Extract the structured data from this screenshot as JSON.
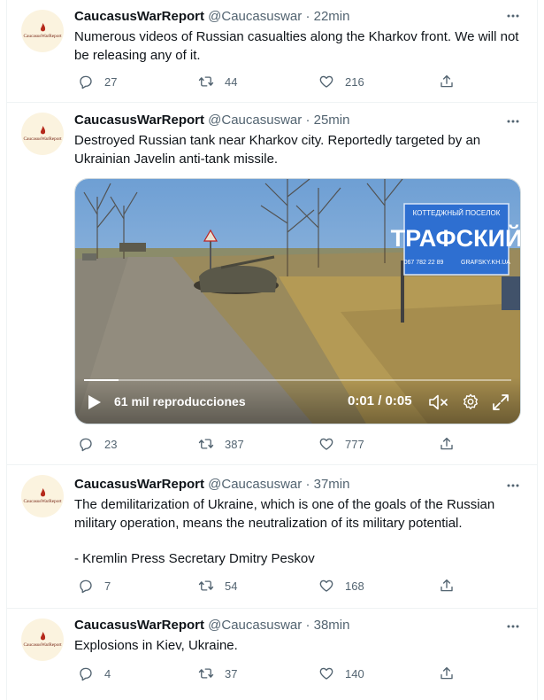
{
  "account": {
    "name": "CaucasusWarReport",
    "handle": "@Caucasuswar",
    "avatar_text": "CaucasusWarReport"
  },
  "tweets": [
    {
      "time": "22min",
      "text": [
        "Numerous videos of Russian casualties along the Kharkov front. We will not be releasing any of it."
      ],
      "replies": "27",
      "retweets": "44",
      "likes": "216"
    },
    {
      "time": "25min",
      "text": [
        "Destroyed Russian tank near Kharkov city. Reportedly targeted by an Ukrainian Javelin anti-tank missile."
      ],
      "replies": "23",
      "retweets": "387",
      "likes": "777",
      "video": {
        "views": "61 mil reproducciones",
        "time": "0:01 / 0:05",
        "progress": 0.08,
        "billboard_top": "КОТТЕДЖНЫЙ ПОСЕЛОК",
        "billboard_main": "ТРАФСКИЙ",
        "billboard_phone": "067 782 22 89",
        "billboard_site": "GRAFSKY.KH.UA"
      }
    },
    {
      "time": "37min",
      "text": [
        "The demilitarization of Ukraine, which is one of the goals of the Russian military operation, means the neutralization of its military potential.",
        "- Kremlin Press Secretary Dmitry Peskov"
      ],
      "replies": "7",
      "retweets": "54",
      "likes": "168"
    },
    {
      "time": "38min",
      "text": [
        "Explosions in Kiev, Ukraine."
      ],
      "replies": "4",
      "retweets": "37",
      "likes": "140"
    }
  ],
  "separator": "·",
  "colors": {
    "text": "#0f1419",
    "secondary": "#536471",
    "border": "#eff3f4",
    "avatar_bg": "#fbf3df",
    "billboard": "#2e6fd1"
  }
}
